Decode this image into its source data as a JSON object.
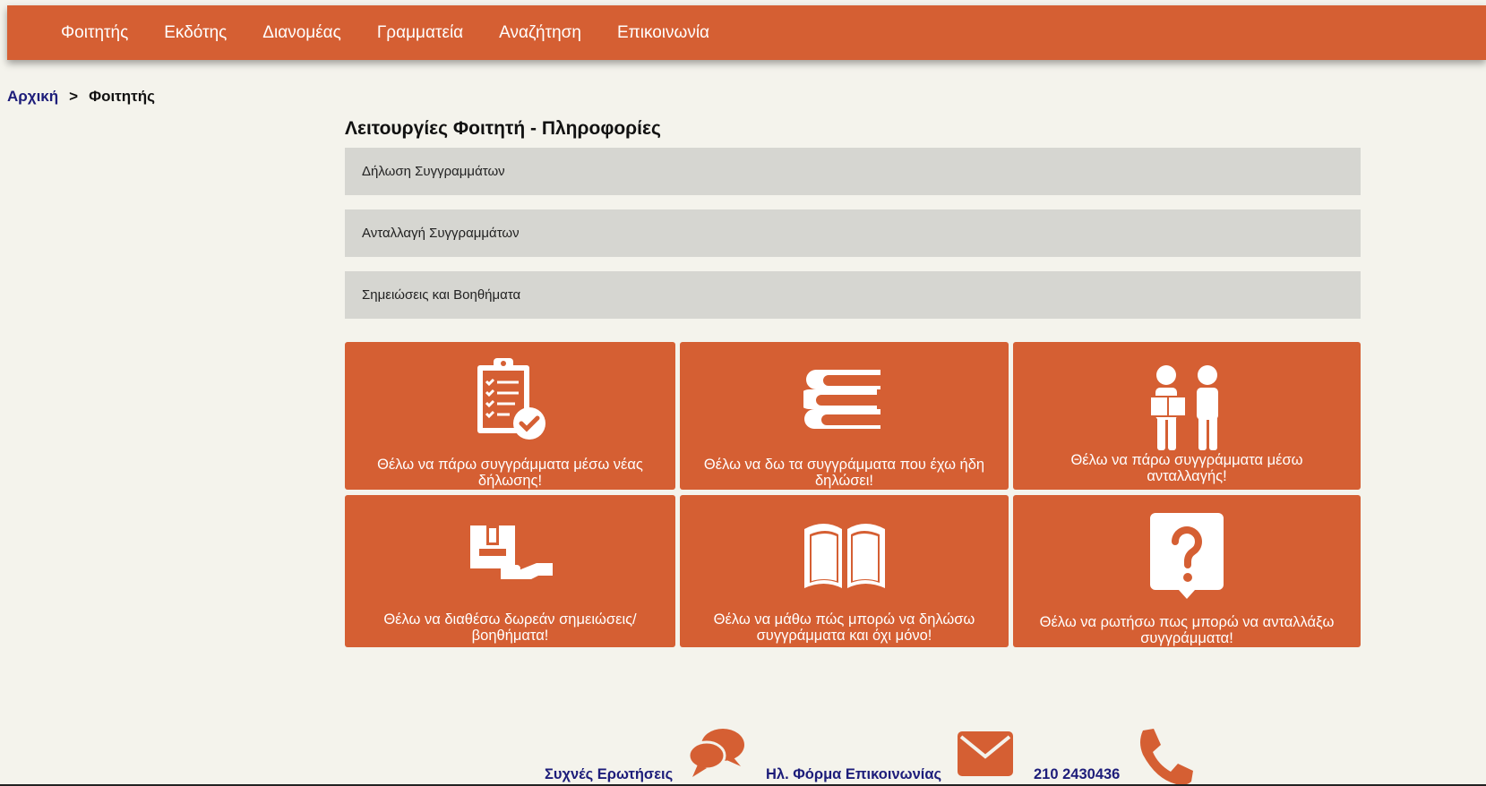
{
  "nav": {
    "items": [
      "Φοιτητής",
      "Εκδότης",
      "Διανομέας",
      "Γραμματεία",
      "Αναζήτηση",
      "Επικοινωνία"
    ]
  },
  "breadcrumb": {
    "home": "Αρχική",
    "separator": ">",
    "current": "Φοιτητής"
  },
  "main": {
    "title": "Λειτουργίες Φοιτητή - Πληροφορίες",
    "accordion": [
      "Δήλωση Συγγραμμάτων",
      "Ανταλλαγή Συγγραμμάτων",
      "Σημειώσεις και Βοηθήματα"
    ],
    "tiles": [
      {
        "label": "Θέλω να πάρω συγγράμματα μέσω νέας δήλωσης!",
        "icon": "clipboard-check-icon"
      },
      {
        "label": "Θέλω να δω τα συγγράμματα που έχω ήδη δηλώσει!",
        "icon": "books-stack-icon"
      },
      {
        "label": "Θέλω να πάρω συγγράμματα μέσω ανταλλαγής!",
        "icon": "people-exchange-icon"
      },
      {
        "label": "Θέλω να διαθέσω δωρεάν σημειώσεις/ βοηθήματα!",
        "icon": "hand-box-icon"
      },
      {
        "label": "Θέλω να μάθω πώς μπορώ να δηλώσω συγγράμματα και όχι μόνο!",
        "icon": "open-book-icon"
      },
      {
        "label": "Θέλω να ρωτήσω πως μπορώ να ανταλλάξω συγγράμματα!",
        "icon": "question-bubble-icon"
      }
    ]
  },
  "footer": {
    "faq": "Συχνές Ερωτήσεις",
    "contact_form": "Ηλ. Φόρμα Επικοινωνίας",
    "phone": "210 2430436"
  },
  "colors": {
    "accent": "#d55f33",
    "background": "#f4f3ec",
    "accordion": "#d6d6d1",
    "link": "#1d1d7a"
  }
}
